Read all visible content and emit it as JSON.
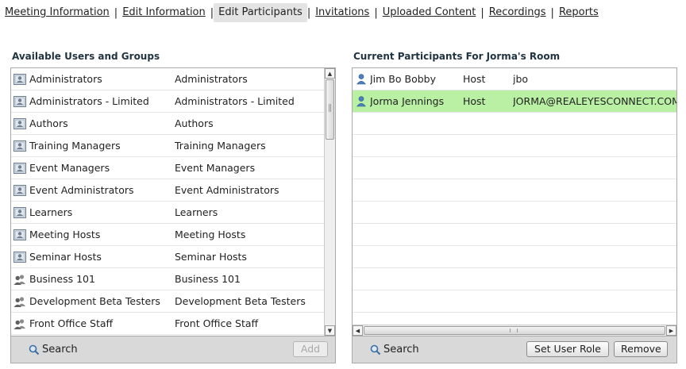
{
  "tabs": [
    {
      "label": "Meeting Information",
      "active": false
    },
    {
      "label": "Edit Information",
      "active": false
    },
    {
      "label": "Edit Participants",
      "active": true
    },
    {
      "label": "Invitations",
      "active": false
    },
    {
      "label": "Uploaded Content",
      "active": false
    },
    {
      "label": "Recordings",
      "active": false
    },
    {
      "label": "Reports",
      "active": false
    }
  ],
  "available": {
    "title": "Available Users and Groups",
    "items": [
      {
        "name": "Administrators",
        "group": "Administrators",
        "icon": "built-in-group-icon"
      },
      {
        "name": "Administrators - Limited",
        "group": "Administrators - Limited",
        "icon": "built-in-group-icon"
      },
      {
        "name": "Authors",
        "group": "Authors",
        "icon": "built-in-group-icon"
      },
      {
        "name": "Training Managers",
        "group": "Training Managers",
        "icon": "built-in-group-icon"
      },
      {
        "name": "Event Managers",
        "group": "Event Managers",
        "icon": "built-in-group-icon"
      },
      {
        "name": "Event Administrators",
        "group": "Event Administrators",
        "icon": "built-in-group-icon"
      },
      {
        "name": "Learners",
        "group": "Learners",
        "icon": "built-in-group-icon"
      },
      {
        "name": "Meeting Hosts",
        "group": "Meeting Hosts",
        "icon": "built-in-group-icon"
      },
      {
        "name": "Seminar Hosts",
        "group": "Seminar Hosts",
        "icon": "built-in-group-icon"
      },
      {
        "name": "Business 101",
        "group": "Business 101",
        "icon": "custom-group-icon"
      },
      {
        "name": "Development Beta Testers",
        "group": "Development Beta Testers",
        "icon": "custom-group-icon"
      },
      {
        "name": "Front Office Staff",
        "group": "Front Office Staff",
        "icon": "custom-group-icon"
      }
    ],
    "search_label": "Search",
    "add_label": "Add"
  },
  "participants": {
    "title": "Current Participants For Jorma's Room",
    "items": [
      {
        "name": "Jim Bo Bobby",
        "role": "Host",
        "login": "jbo",
        "selected": false
      },
      {
        "name": "Jorma Jennings",
        "role": "Host",
        "login": "JORMA@REALEYESCONNECT.COM",
        "selected": true
      }
    ],
    "search_label": "Search",
    "set_role_label": "Set User Role",
    "remove_label": "Remove"
  }
}
